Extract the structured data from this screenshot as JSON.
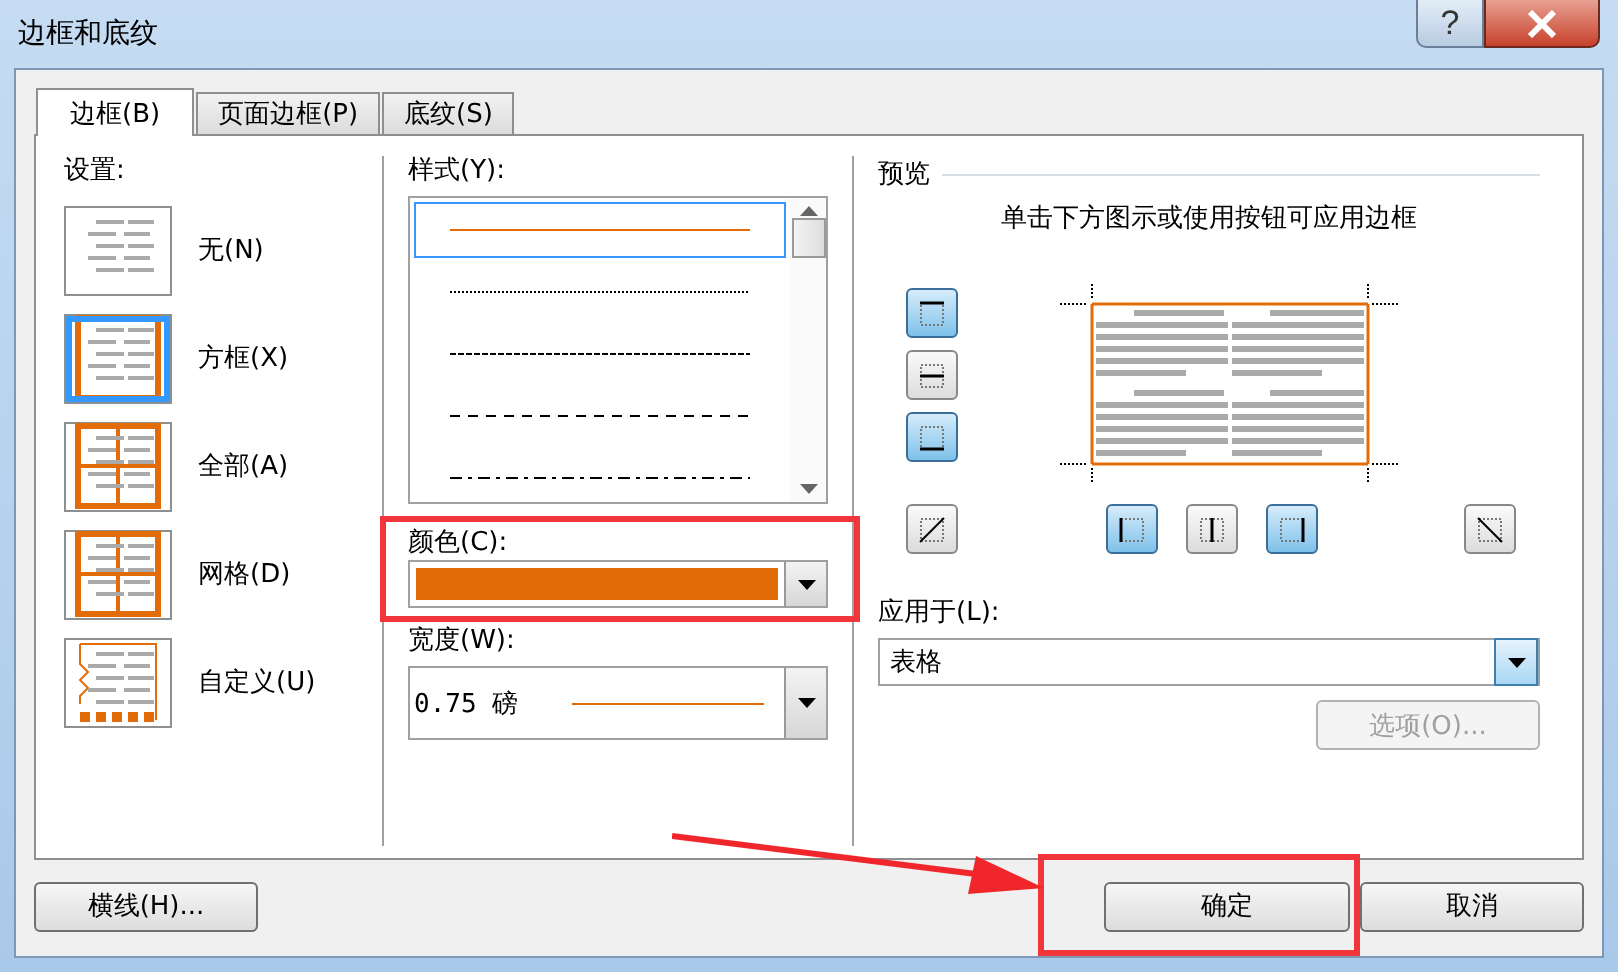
{
  "window": {
    "title": "边框和底纹",
    "help": "?"
  },
  "tabs": [
    {
      "label": "边框(B)",
      "selected": true
    },
    {
      "label": "页面边框(P)",
      "selected": false
    },
    {
      "label": "底纹(S)",
      "selected": false
    }
  ],
  "settings": {
    "label": "设置:",
    "items": [
      {
        "kind": "none",
        "label": "无(N)",
        "selected": false
      },
      {
        "kind": "box",
        "label": "方框(X)",
        "selected": true
      },
      {
        "kind": "all",
        "label": "全部(A)",
        "selected": false
      },
      {
        "kind": "grid",
        "label": "网格(D)",
        "selected": false
      },
      {
        "kind": "custom",
        "label": "自定义(U)",
        "selected": false
      }
    ]
  },
  "style": {
    "label": "样式(Y):",
    "options": [
      {
        "kind": "solid",
        "selected": true
      },
      {
        "kind": "dotted",
        "selected": false
      },
      {
        "kind": "fine-dash",
        "selected": false
      },
      {
        "kind": "dash",
        "selected": false
      },
      {
        "kind": "dash-dot",
        "selected": false
      }
    ]
  },
  "color": {
    "label": "颜色(C):",
    "color": "#e36c09",
    "highlighted": true
  },
  "width": {
    "label": "宽度(W):",
    "value": "0.75 磅"
  },
  "preview": {
    "label": "预览",
    "hint": "单击下方图示或使用按钮可应用边框",
    "edges": [
      {
        "kind": "top",
        "selected": true
      },
      {
        "kind": "hmiddle",
        "selected": false
      },
      {
        "kind": "bottom",
        "selected": true
      },
      {
        "kind": "diag-up",
        "selected": false
      },
      {
        "kind": "left",
        "selected": true
      },
      {
        "kind": "vmiddle",
        "selected": false
      },
      {
        "kind": "right",
        "selected": true
      },
      {
        "kind": "diag-down",
        "selected": false
      }
    ]
  },
  "apply_to": {
    "label": "应用于(L):",
    "value": "表格"
  },
  "options_button": {
    "label": "选项(O)...",
    "disabled": true
  },
  "footer": {
    "horizontal_line": "横线(H)...",
    "ok": {
      "label": "确定",
      "highlighted": true
    },
    "cancel": "取消"
  }
}
